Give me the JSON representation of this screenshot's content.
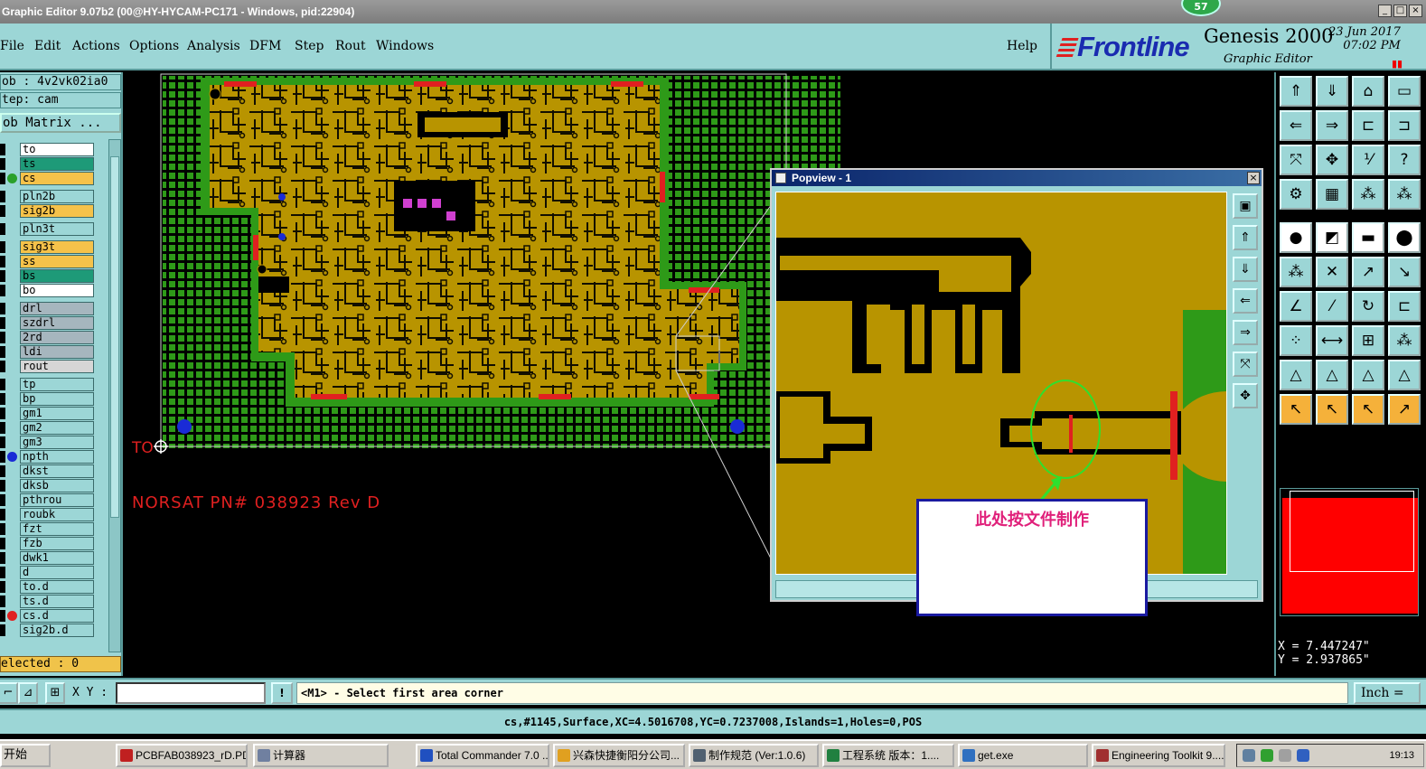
{
  "window": {
    "title": "Graphic Editor 9.07b2 (00@HY-HYCAM-PC171 - Windows, pid:22904)",
    "badge": "57",
    "controls": [
      "_",
      "□",
      "×"
    ]
  },
  "menu": {
    "items": [
      "File",
      "Edit",
      "Actions",
      "Options",
      "Analysis",
      "DFM",
      "Step",
      "Rout",
      "Windows"
    ],
    "help": "Help"
  },
  "brand": {
    "logo": "Frontline",
    "product": "Genesis 2000",
    "subtitle": "Graphic Editor",
    "date": "23 Jun 2017",
    "time": "07:02 PM"
  },
  "left_panel": {
    "job": "ob : 4v2vk02ia0",
    "step": "tep: cam",
    "job_matrix": "ob Matrix ...",
    "selected": "elected : 0",
    "layers": [
      {
        "name": "to",
        "color": "#ffffff",
        "dot": ""
      },
      {
        "name": "ts",
        "color": "#1e9a78",
        "dot": ""
      },
      {
        "name": "cs",
        "color": "#f5c24a",
        "dot": "#2aa02a"
      },
      {
        "name": "pln2b",
        "color": "#9cd6d6",
        "dot": ""
      },
      {
        "name": "sig2b",
        "color": "#f5c24a",
        "dot": ""
      },
      {
        "name": "pln3t",
        "color": "#9cd6d6",
        "dot": ""
      },
      {
        "name": "sig3t",
        "color": "#f5c24a",
        "dot": ""
      },
      {
        "name": "ss",
        "color": "#f5c24a",
        "dot": ""
      },
      {
        "name": "bs",
        "color": "#1e9a78",
        "dot": ""
      },
      {
        "name": "bo",
        "color": "#ffffff",
        "dot": ""
      },
      {
        "name": "drl",
        "color": "#a6b6be",
        "dot": ""
      },
      {
        "name": "szdrl",
        "color": "#a6b6be",
        "dot": ""
      },
      {
        "name": "2rd",
        "color": "#a6b6be",
        "dot": ""
      },
      {
        "name": "ldi",
        "color": "#a6b6be",
        "dot": ""
      },
      {
        "name": "rout",
        "color": "#d6d6d6",
        "dot": ""
      },
      {
        "name": "tp",
        "color": "#9cd6d6",
        "dot": ""
      },
      {
        "name": "bp",
        "color": "#9cd6d6",
        "dot": ""
      },
      {
        "name": "gm1",
        "color": "#9cd6d6",
        "dot": ""
      },
      {
        "name": "gm2",
        "color": "#9cd6d6",
        "dot": ""
      },
      {
        "name": "gm3",
        "color": "#9cd6d6",
        "dot": ""
      },
      {
        "name": "npth",
        "color": "#9cd6d6",
        "dot": "#1a2bd6"
      },
      {
        "name": "dkst",
        "color": "#9cd6d6",
        "dot": ""
      },
      {
        "name": "dksb",
        "color": "#9cd6d6",
        "dot": ""
      },
      {
        "name": "pthrou",
        "color": "#9cd6d6",
        "dot": ""
      },
      {
        "name": "roubk",
        "color": "#9cd6d6",
        "dot": ""
      },
      {
        "name": "fzt",
        "color": "#9cd6d6",
        "dot": ""
      },
      {
        "name": "fzb",
        "color": "#9cd6d6",
        "dot": ""
      },
      {
        "name": "dwk1",
        "color": "#9cd6d6",
        "dot": ""
      },
      {
        "name": "d",
        "color": "#9cd6d6",
        "dot": ""
      },
      {
        "name": "to.d",
        "color": "#9cd6d6",
        "dot": ""
      },
      {
        "name": "ts.d",
        "color": "#9cd6d6",
        "dot": ""
      },
      {
        "name": "cs.d",
        "color": "#9cd6d6",
        "dot": "#e02020"
      },
      {
        "name": "sig2b.d",
        "color": "#9cd6d6",
        "dot": ""
      }
    ]
  },
  "canvas": {
    "pn_label": "NORSAT PN# 038923 Rev D",
    "origin_label": "TO",
    "colors": {
      "copper": "#b89400",
      "mask": "#2e9a18",
      "trace": "#000000",
      "pad": "#e02020"
    }
  },
  "popview": {
    "title": "Popview - 1",
    "close": "×"
  },
  "note": {
    "text": "此处按文件制作"
  },
  "right_panel": {
    "coord_x": "X = 7.447247\"",
    "coord_y": "Y = 2.937865\"",
    "tool_colors": [
      "#9cd6d6",
      "#f5b13a",
      "#ffffff"
    ]
  },
  "command": {
    "xy_label": "X Y :",
    "xy_value": "",
    "prompt": "<M1> - Select first area corner",
    "unit": "Inch ="
  },
  "status": {
    "text": "cs,#1145,Surface,XC=4.5016708,YC=0.7237008,Islands=1,Holes=0,POS"
  },
  "taskbar": {
    "start": "开始",
    "tasks": [
      {
        "label": "PCBFAB038923_rD.PD...",
        "icon": "#c02020"
      },
      {
        "label": "计算器",
        "icon": "#7080a0"
      },
      {
        "label": "Total Commander 7.0 ...",
        "icon": "#2050c0"
      },
      {
        "label": "兴森快捷衡阳分公司...",
        "icon": "#e0a020"
      },
      {
        "label": "制作规范 (Ver:1.0.6)",
        "icon": "#506070"
      },
      {
        "label": "工程系统  版本：1....",
        "icon": "#208040"
      },
      {
        "label": "get.exe",
        "icon": "#3070c0"
      },
      {
        "label": "Engineering Toolkit 9....",
        "icon": "#a03030"
      }
    ],
    "clock": "19:13"
  }
}
